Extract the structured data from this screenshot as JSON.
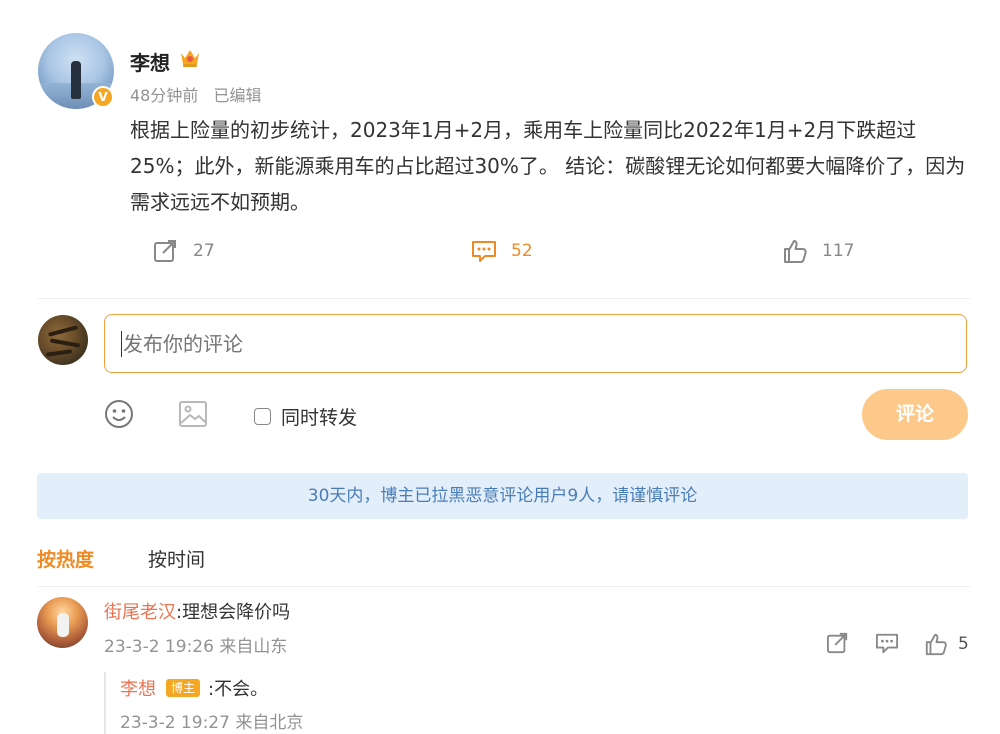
{
  "post": {
    "author": "李想",
    "time": "48分钟前",
    "edited": "已编辑",
    "text": "根据上险量的初步统计，2023年1月+2月，乘用车上险量同比2022年1月+2月下跌超过25%；此外，新能源乘用车的占比超过30%了。 结论：碳酸锂无论如何都要大幅降价了，因为需求远远不如预期。",
    "repost_count": "27",
    "comment_count": "52",
    "like_count": "117",
    "verified_mark": "V"
  },
  "composer": {
    "placeholder": "发布你的评论",
    "repost_label": "同时转发",
    "submit_label": "评论"
  },
  "notice": "30天内，博主已拉黑恶意评论用户9人，请谨慎评论",
  "sort": {
    "hot": "按热度",
    "time": "按时间"
  },
  "comments": [
    {
      "user": "街尾老汉",
      "text": ":理想会降价吗",
      "meta": "23-3-2 19:26 来自山东",
      "likes": "5",
      "reply": {
        "user": "李想",
        "badge": "博主",
        "text": ":不会。",
        "meta": "23-3-2 19:27 来自北京"
      }
    }
  ],
  "colors": {
    "accent": "#f08a24",
    "name": "#eb7350",
    "notice_bg": "#e2eef9",
    "notice_text": "#4a7db8",
    "submit_bg": "#fdc98a"
  }
}
